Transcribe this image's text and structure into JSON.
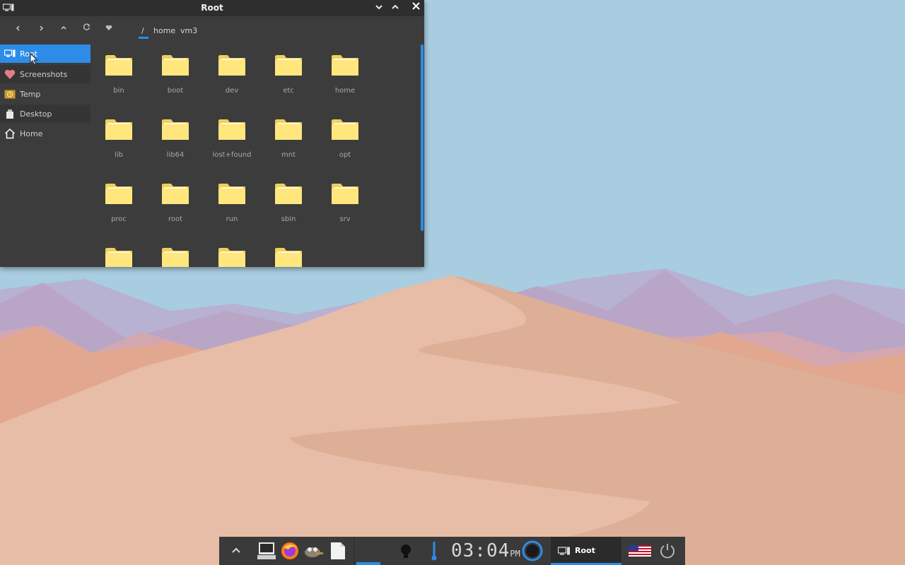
{
  "window": {
    "title": "Root",
    "icons": {
      "app": "computer-icon",
      "minimize": "chevron-down-icon",
      "maximize": "chevron-up-icon",
      "close": "close-icon"
    }
  },
  "toolbar": {
    "nav": [
      "back-icon",
      "forward-icon",
      "up-icon",
      "refresh-icon",
      "heart-icon"
    ],
    "breadcrumb": [
      "/",
      "home",
      "vm3"
    ]
  },
  "sidebar": {
    "items": [
      {
        "label": "Root",
        "icon": "computer-icon",
        "active": true
      },
      {
        "label": "Screenshots",
        "icon": "heart-icon"
      },
      {
        "label": "Temp",
        "icon": "temp-folder-icon"
      },
      {
        "label": "Desktop",
        "icon": "desktop-icon"
      },
      {
        "label": "Home",
        "icon": "home-icon"
      }
    ]
  },
  "files": [
    "bin",
    "boot",
    "dev",
    "etc",
    "home",
    "lib",
    "lib64",
    "lost+found",
    "mnt",
    "opt",
    "proc",
    "root",
    "run",
    "sbin",
    "srv",
    "",
    "",
    "",
    ""
  ],
  "taskbar": {
    "clock": "03:04",
    "ampm": "PM",
    "task": "Root",
    "colors": {
      "accent": "#2d8ce8",
      "panel": "#3a3a3a"
    }
  }
}
